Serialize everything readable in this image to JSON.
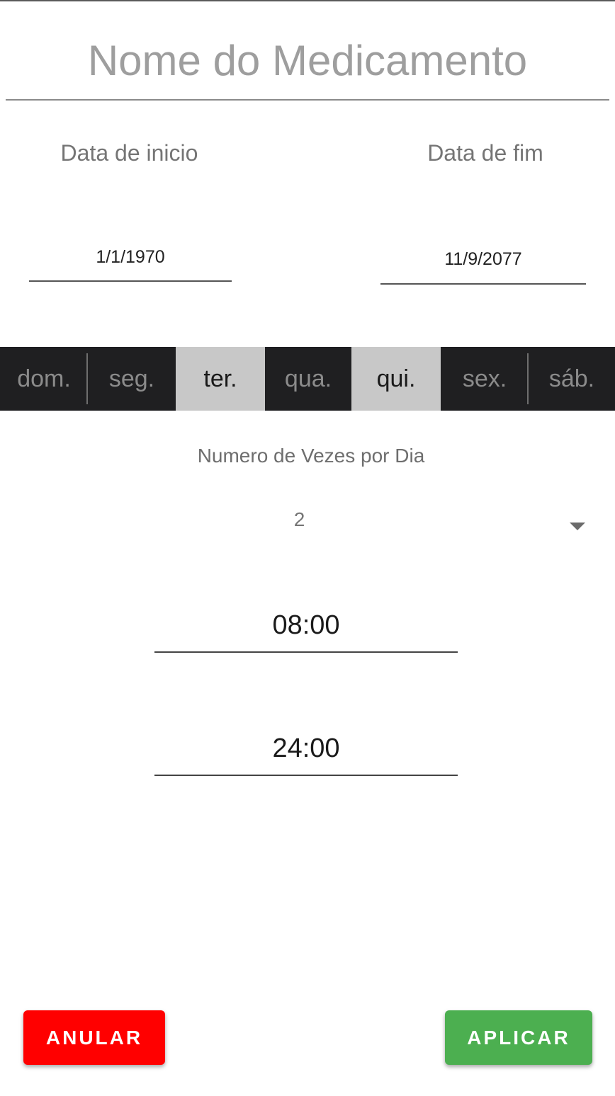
{
  "form": {
    "medication_name_placeholder": "Nome do Medicamento",
    "start_date_label": "Data de inicio",
    "end_date_label": "Data de fim",
    "start_date_value": "1/1/1970",
    "end_date_value": "11/9/2077",
    "weekdays": [
      {
        "label": "dom.",
        "selected": false
      },
      {
        "label": "seg.",
        "selected": false
      },
      {
        "label": "ter.",
        "selected": true
      },
      {
        "label": "qua.",
        "selected": false
      },
      {
        "label": "qui.",
        "selected": true
      },
      {
        "label": "sex.",
        "selected": false
      },
      {
        "label": "sáb.",
        "selected": false
      }
    ],
    "times_per_day_label": "Numero de Vezes por Dia",
    "times_per_day_value": "2",
    "time_values": [
      "08:00",
      "24:00"
    ]
  },
  "actions": {
    "cancel_label": "ANULAR",
    "apply_label": "APLICAR"
  },
  "colors": {
    "cancel_button": "#ff0000",
    "apply_button": "#4caf50",
    "weekday_bar": "#1f1f21",
    "weekday_selected": "#c8c8c8"
  },
  "icons": {
    "dropdown": "dropdown-arrow-icon"
  }
}
